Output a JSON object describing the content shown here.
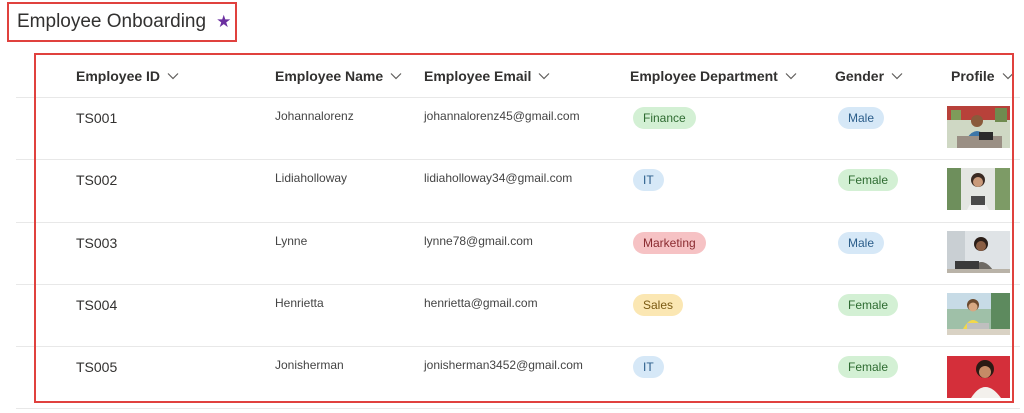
{
  "page": {
    "title": "Employee Onboarding",
    "favorite_icon": "star-icon",
    "accent": "#6b2fa0"
  },
  "columns": [
    {
      "label": "Employee ID"
    },
    {
      "label": "Employee Name"
    },
    {
      "label": "Employee Email"
    },
    {
      "label": "Employee Department"
    },
    {
      "label": "Gender"
    },
    {
      "label": "Profile"
    }
  ],
  "rows": [
    {
      "id": "TS001",
      "name": "Johannalorenz",
      "email": "johannalorenz45@gmail.com",
      "department": "Finance",
      "dept_bg": "#d3f0d4",
      "dept_fg": "#2e6b31",
      "gender": "Male",
      "gender_bg": "#d6e8f7",
      "gender_fg": "#2b5d8a",
      "photo": "person-at-laptop-photo"
    },
    {
      "id": "TS002",
      "name": "Lidiaholloway",
      "email": "lidiaholloway34@gmail.com",
      "department": "IT",
      "dept_bg": "#d6e8f7",
      "dept_fg": "#2b5d8a",
      "gender": "Female",
      "gender_bg": "#d3f0d4",
      "gender_fg": "#2e6b31",
      "photo": "woman-with-tablet-photo"
    },
    {
      "id": "TS003",
      "name": "Lynne",
      "email": "lynne78@gmail.com",
      "department": "Marketing",
      "dept_bg": "#f6c2c4",
      "dept_fg": "#8a2b30",
      "gender": "Male",
      "gender_bg": "#d6e8f7",
      "gender_fg": "#2b5d8a",
      "photo": "man-at-desk-photo"
    },
    {
      "id": "TS004",
      "name": "Henrietta",
      "email": "henrietta@gmail.com",
      "department": "Sales",
      "dept_bg": "#fbe7b3",
      "dept_fg": "#7a5a12",
      "gender": "Female",
      "gender_bg": "#d3f0d4",
      "gender_fg": "#2e6b31",
      "photo": "woman-outdoors-laptop-photo"
    },
    {
      "id": "TS005",
      "name": "Jonisherman",
      "email": "jonisherman3452@gmail.com",
      "department": "IT",
      "dept_bg": "#d6e8f7",
      "dept_fg": "#2b5d8a",
      "gender": "Female",
      "gender_bg": "#d3f0d4",
      "gender_fg": "#2e6b31",
      "photo": "woman-red-background-photo"
    }
  ]
}
